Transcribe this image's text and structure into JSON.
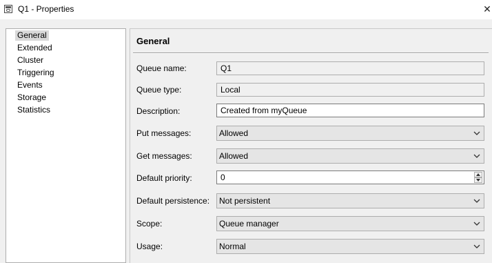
{
  "window": {
    "title": "Q1 - Properties",
    "icon": "queue-properties-icon",
    "close_glyph": "✕"
  },
  "nav": {
    "items": [
      {
        "label": "General",
        "selected": true
      },
      {
        "label": "Extended"
      },
      {
        "label": "Cluster"
      },
      {
        "label": "Triggering"
      },
      {
        "label": "Events"
      },
      {
        "label": "Storage"
      },
      {
        "label": "Statistics"
      }
    ]
  },
  "section": {
    "title": "General"
  },
  "fields": {
    "queue_name": {
      "label": "Queue name:",
      "value": "Q1"
    },
    "queue_type": {
      "label": "Queue type:",
      "value": "Local"
    },
    "description": {
      "label": "Description:",
      "value": "Created from myQueue"
    },
    "put_messages": {
      "label": "Put messages:",
      "value": "Allowed"
    },
    "get_messages": {
      "label": "Get messages:",
      "value": "Allowed"
    },
    "default_priority": {
      "label": "Default priority:",
      "value": "0"
    },
    "default_persistence": {
      "label": "Default persistence:",
      "value": "Not persistent"
    },
    "scope": {
      "label": "Scope:",
      "value": "Queue manager"
    },
    "usage": {
      "label": "Usage:",
      "value": "Normal"
    }
  }
}
